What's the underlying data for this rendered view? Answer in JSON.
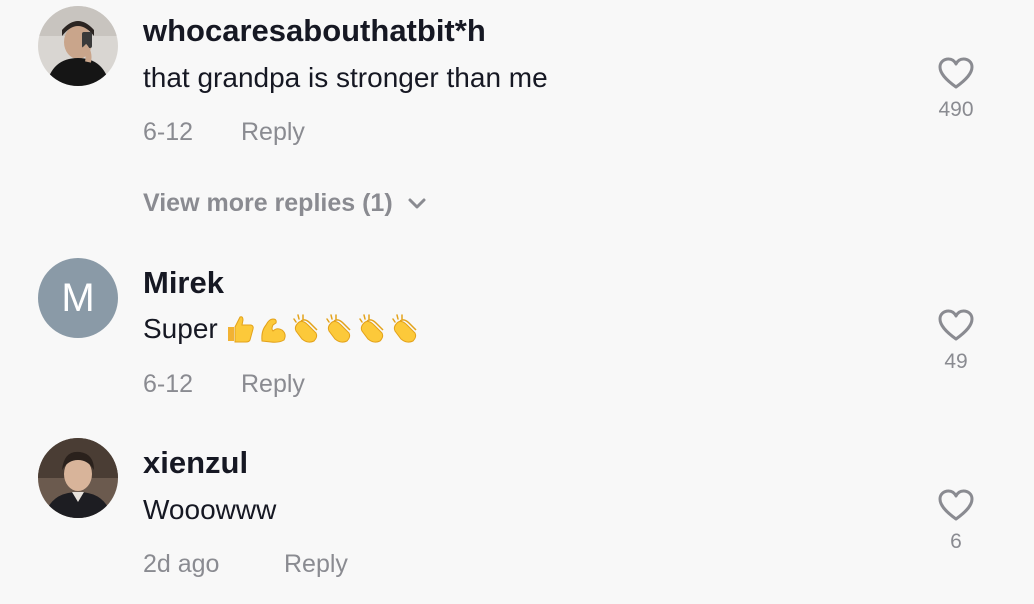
{
  "comments": [
    {
      "username": "whocaresabouthatbit*h",
      "text": "that grandpa is stronger than me",
      "date": "6-12",
      "reply_label": "Reply",
      "likes": "490",
      "avatar": "photo"
    },
    {
      "username": "Mirek",
      "text": "Super",
      "emojis": [
        "thumbs-up",
        "flexed-biceps",
        "clapping-hands",
        "clapping-hands",
        "clapping-hands",
        "clapping-hands"
      ],
      "date": "6-12",
      "reply_label": "Reply",
      "likes": "49",
      "avatar_letter": "M"
    },
    {
      "username": "xienzul",
      "text": "Wooowww",
      "date": "2d ago",
      "reply_label": "Reply",
      "likes": "6",
      "avatar": "photo"
    }
  ],
  "view_more_replies": "View more replies (1)",
  "colors": {
    "background": "#f8f8f8",
    "primary_text": "#161823",
    "secondary_text": "#8a8b91",
    "avatar_letter_bg": "#8a9aa7"
  }
}
